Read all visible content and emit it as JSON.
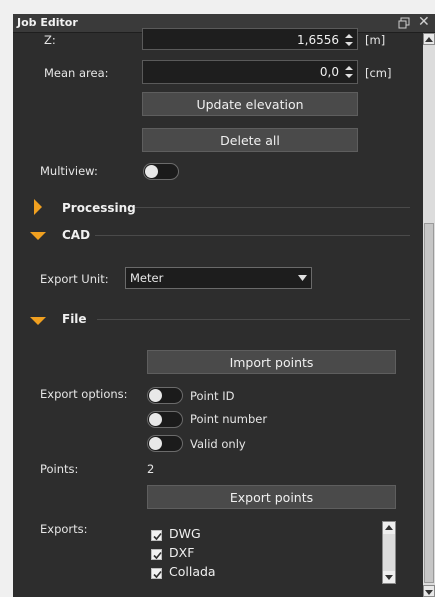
{
  "window": {
    "title": "Job Editor"
  },
  "z": {
    "label": "Z:",
    "value": "1,6556",
    "unit": "[m]"
  },
  "mean_area": {
    "label": "Mean area:",
    "value": "0,0",
    "unit": "[cm]"
  },
  "buttons": {
    "update_elevation": "Update elevation",
    "delete_all": "Delete all",
    "import_points": "Import points",
    "export_points": "Export points"
  },
  "multiview": {
    "label": "Multiview:",
    "enabled": false
  },
  "sections": {
    "processing": "Processing",
    "cad": "CAD",
    "file": "File"
  },
  "export_unit": {
    "label": "Export Unit:",
    "value": "Meter"
  },
  "export_options": {
    "label": "Export options:",
    "items": [
      {
        "label": "Point ID",
        "enabled": false
      },
      {
        "label": "Point number",
        "enabled": false
      },
      {
        "label": "Valid only",
        "enabled": false
      }
    ]
  },
  "points": {
    "label": "Points:",
    "value": "2"
  },
  "exports": {
    "label": "Exports:",
    "items": [
      {
        "label": "DWG",
        "checked": true
      },
      {
        "label": "DXF",
        "checked": true
      },
      {
        "label": "Collada",
        "checked": true
      }
    ]
  },
  "colors": {
    "panel_bg": "#2d2d2d",
    "accent": "#f0a020",
    "button_bg": "#4a4a4a"
  },
  "icons": [
    "restore-icon",
    "close-icon",
    "chevron-right-icon",
    "chevron-down-icon",
    "dropdown-arrow-icon",
    "checkbox-checked-icon"
  ]
}
